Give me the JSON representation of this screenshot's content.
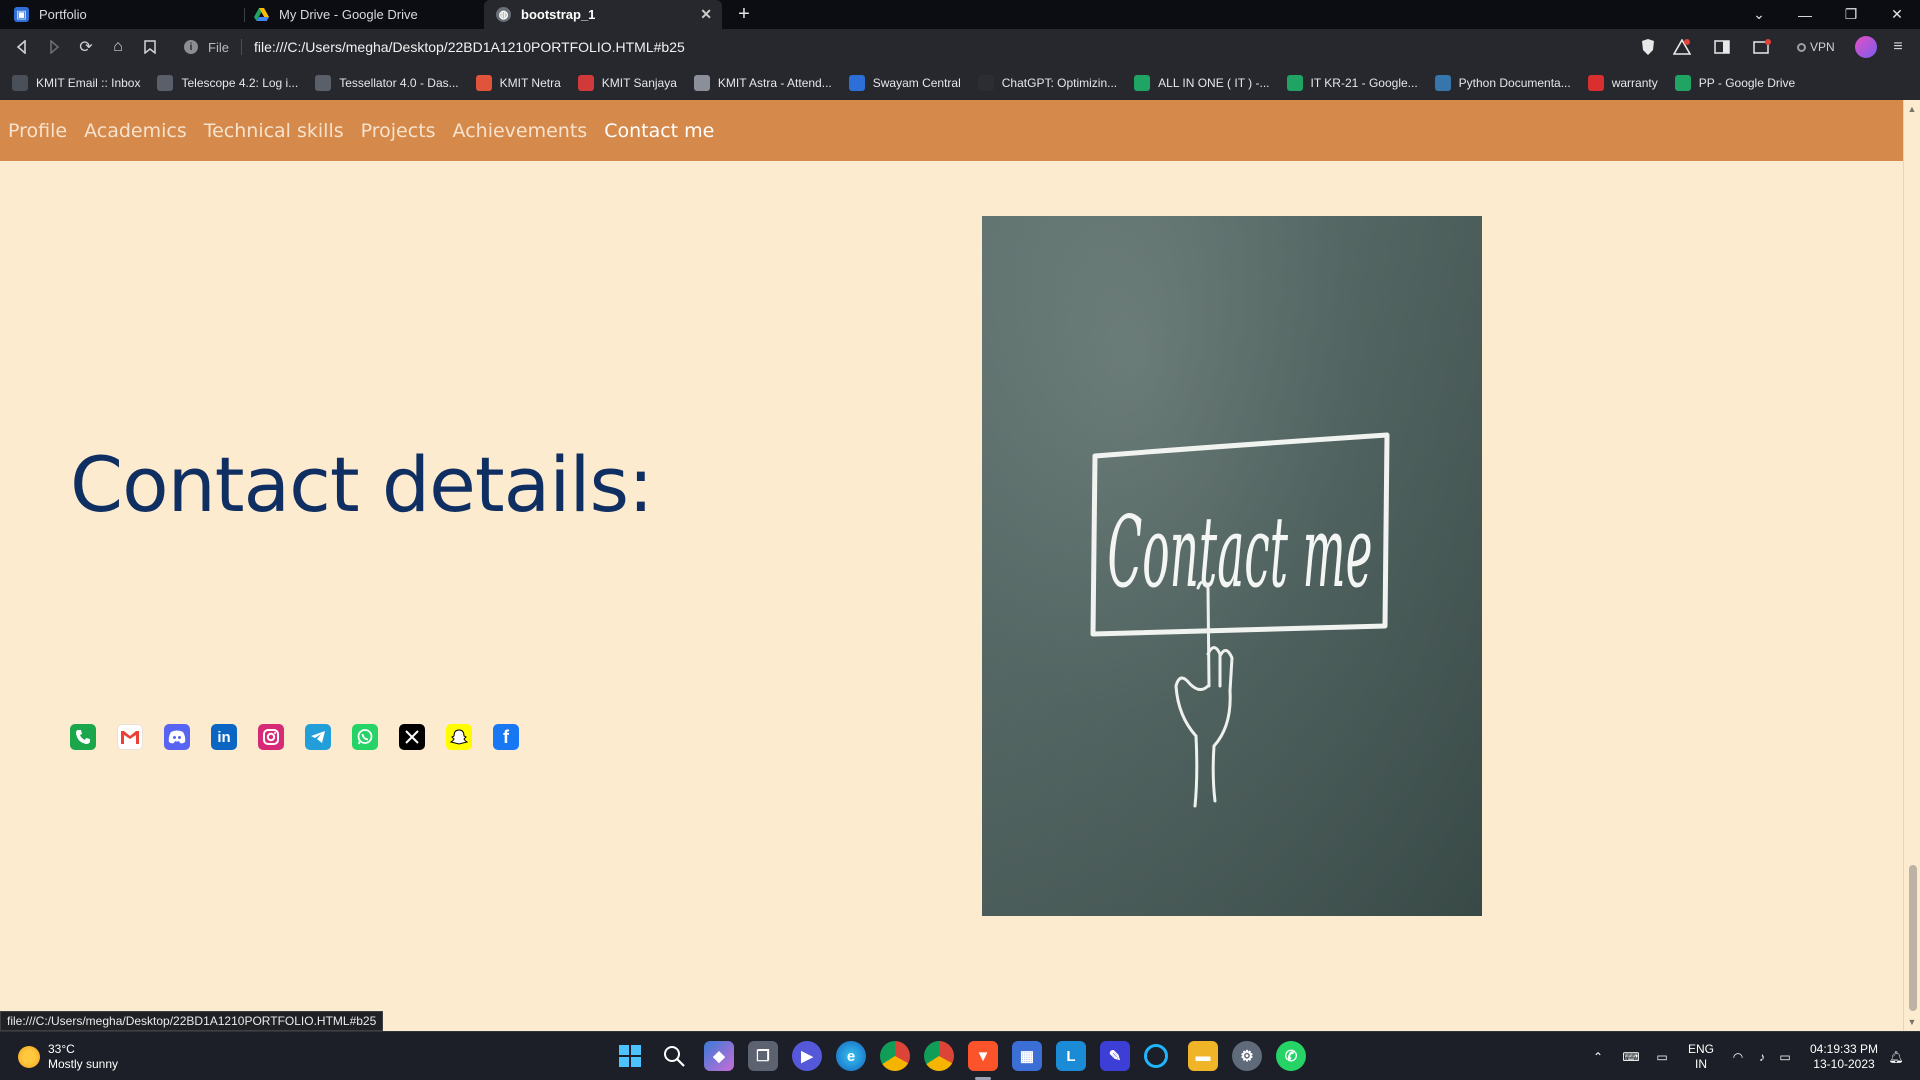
{
  "browser": {
    "tabs": [
      {
        "title": "Portfolio",
        "active": false
      },
      {
        "title": "My Drive - Google Drive",
        "active": false
      },
      {
        "title": "bootstrap_1",
        "active": true
      }
    ],
    "address": {
      "scheme_label": "File",
      "url": "file:///C:/Users/megha/Desktop/22BD1A1210PORTFOLIO.HTML#b25"
    },
    "vpn_label": "VPN",
    "bookmarks": [
      {
        "label": "KMIT Email :: Inbox",
        "color": "#4a4f5a"
      },
      {
        "label": "Telescope 4.2: Log i...",
        "color": "#5a5f6a"
      },
      {
        "label": "Tessellator 4.0 - Das...",
        "color": "#5a5f6a"
      },
      {
        "label": "KMIT Netra",
        "color": "#e0553a"
      },
      {
        "label": "KMIT Sanjaya",
        "color": "#d23a3a"
      },
      {
        "label": "KMIT Astra - Attend...",
        "color": "#8a8f99"
      },
      {
        "label": "Swayam Central",
        "color": "#2c6fd6"
      },
      {
        "label": "ChatGPT: Optimizin...",
        "color": "#2b2d33"
      },
      {
        "label": "ALL IN ONE ( IT ) -...",
        "color": "#1fa463"
      },
      {
        "label": "IT KR-21 - Google...",
        "color": "#1fa463"
      },
      {
        "label": "Python Documenta...",
        "color": "#3776ab"
      },
      {
        "label": "warranty",
        "color": "#d92f2f"
      },
      {
        "label": "PP - Google Drive",
        "color": "#1fa463"
      }
    ]
  },
  "site": {
    "nav": [
      "Profile",
      "Academics",
      "Technical skills",
      "Projects",
      "Achievements",
      "Contact me"
    ],
    "active_nav": "Contact me",
    "heading": "Contact details:",
    "social_icons": [
      {
        "name": "phone-icon",
        "color": "#1aa64a"
      },
      {
        "name": "gmail-icon",
        "color": "#ffffff"
      },
      {
        "name": "discord-icon",
        "color": "#5865f2"
      },
      {
        "name": "linkedin-icon",
        "color": "#0a66c2"
      },
      {
        "name": "instagram-icon",
        "color": "#d62976"
      },
      {
        "name": "telegram-icon",
        "color": "#229ed9"
      },
      {
        "name": "whatsapp-icon",
        "color": "#25d366"
      },
      {
        "name": "x-icon",
        "color": "#000000"
      },
      {
        "name": "snapchat-icon",
        "color": "#fffc00"
      },
      {
        "name": "facebook-icon",
        "color": "#1877f2"
      }
    ],
    "photo_text": "Contact me"
  },
  "status_url": "file:///C:/Users/megha/Desktop/22BD1A1210PORTFOLIO.HTML#b25",
  "taskbar": {
    "weather_temp": "33°C",
    "weather_desc": "Mostly sunny",
    "lang_line1": "ENG",
    "lang_line2": "IN",
    "time": "04:19:33 PM",
    "date": "13-10-2023"
  },
  "colors": {
    "page_bg": "#fdebcf",
    "nav_bg": "#d5894a",
    "heading": "#0f2f62"
  }
}
